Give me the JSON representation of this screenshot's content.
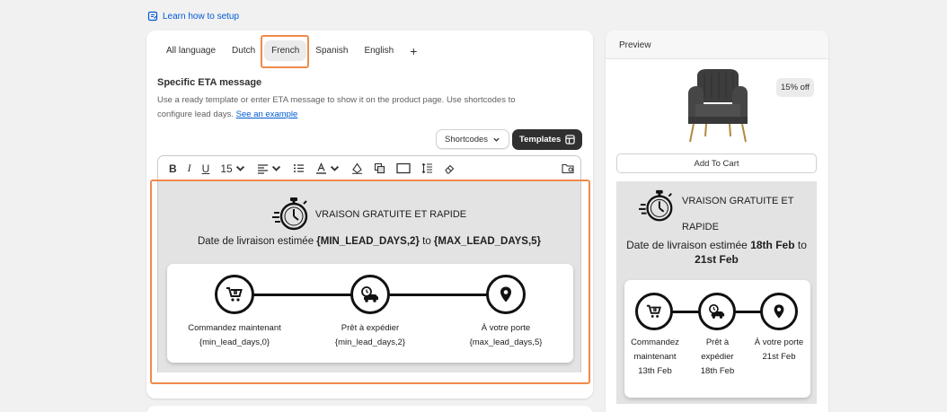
{
  "learn_link": "Learn how to setup",
  "tabs": [
    "All language",
    "Dutch",
    "French",
    "Spanish",
    "English"
  ],
  "tab_add": "+",
  "section": {
    "title": "Specific ETA message",
    "desc": "Use a ready template or enter ETA message to show it on the product page. Use shortcodes to configure lead days.",
    "example_link": "See an example"
  },
  "buttons": {
    "shortcodes": "Shortcodes",
    "templates": "Templates"
  },
  "toolbar": {
    "font_size": "15"
  },
  "editor": {
    "heading": "VRAISON GRATUITE ET RAPIDE",
    "line_prefix": "Date de livraison estimée",
    "min_code": "{MIN_LEAD_DAYS,2}",
    "to": "to",
    "max_code": "{MAX_LEAD_DAYS,5}",
    "steps": [
      {
        "label": "Commandez maintenant",
        "code": "{min_lead_days,0}",
        "icon": "cart-icon"
      },
      {
        "label": "Prêt à expédier",
        "code": "{min_lead_days,2}",
        "icon": "truck-clock-icon"
      },
      {
        "label": "À votre porte",
        "code": "{max_lead_days,5}",
        "icon": "location-pin-icon"
      }
    ]
  },
  "preview": {
    "title": "Preview",
    "discount": "15% off",
    "add_to_cart": "Add To Cart",
    "heading": "VRAISON GRATUITE ET RAPIDE",
    "line_prefix": "Date de livraison estimée",
    "min_date": "18th Feb",
    "to": "to",
    "max_date": "21st Feb",
    "steps": [
      {
        "label1": "Commandez",
        "label2": "maintenant",
        "date": "13th Feb"
      },
      {
        "label1": "Prêt à",
        "label2": "expédier",
        "date": "18th Feb"
      },
      {
        "label1": "À votre porte",
        "label2": "",
        "date": "21st Feb"
      }
    ]
  },
  "colors": {
    "highlight": "#f08a4b",
    "link": "#005bd3",
    "dark_button": "#303030",
    "editor_bg": "#e3e3e3"
  }
}
